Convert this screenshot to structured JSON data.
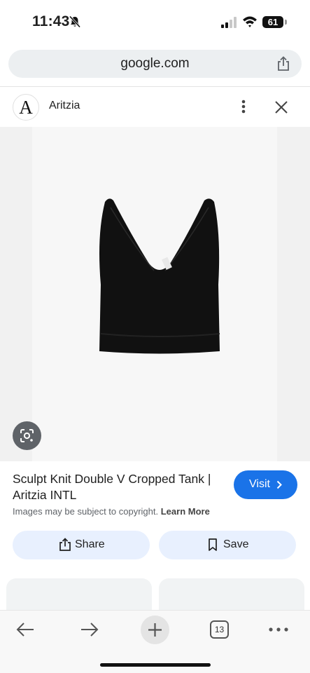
{
  "status_bar": {
    "time": "11:43",
    "battery": "61",
    "icons": [
      "bell-slash-icon",
      "cellular-signal-icon",
      "wifi-icon",
      "battery-icon"
    ]
  },
  "browser": {
    "url": "google.com",
    "tabs_count": "13"
  },
  "site": {
    "logo_letter": "A",
    "name": "Aritzia"
  },
  "product": {
    "title": "Sculpt Knit Double V Cropped Tank | Aritzia INTL",
    "copyright_text": "Images may be subject to copyright.",
    "learn_more": "Learn More",
    "visit_label": "Visit",
    "garment_color": "#111111"
  },
  "actions": {
    "share_label": "Share",
    "save_label": "Save"
  },
  "colors": {
    "accent": "#1a73e8",
    "action_bg": "#e8f0fe"
  }
}
